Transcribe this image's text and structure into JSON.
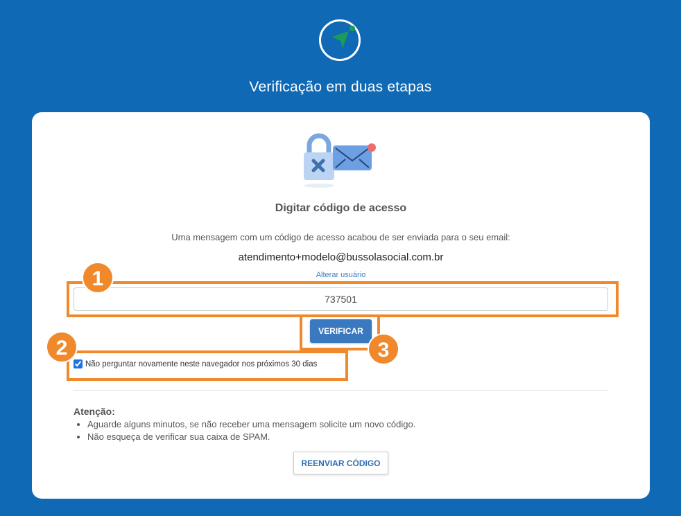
{
  "header": {
    "title": "Verificação em duas etapas"
  },
  "card": {
    "title": "Digitar código de acesso",
    "message": "Uma mensagem com um código de acesso acabou de ser enviada para o seu email:",
    "email": "atendimento+modelo@bussolasocial.com.br",
    "change_user_link": "Alterar usuário",
    "code_value": "737501",
    "verify_label": "VERIFICAR",
    "remember_checked": true,
    "remember_label": "Não perguntar novamente neste navegador nos próximos 30 dias",
    "attention": {
      "heading": "Atenção:",
      "items": [
        "Aguarde alguns minutos, se não receber uma mensagem solicite um novo código.",
        "Não esqueça de verificar sua caixa de SPAM."
      ]
    },
    "resend_label": "REENVIAR CÓDIGO"
  },
  "annotations": {
    "badge_1": "1",
    "badge_2": "2",
    "badge_3": "3",
    "accent_color": "#f0892c"
  },
  "colors": {
    "background": "#1069b4",
    "primary_button": "#3a78c0",
    "logo_arrow": "#1a9b5a"
  },
  "icons": {
    "logo": "compass-arrow-icon",
    "illustration": "lock-and-envelope-icon"
  }
}
